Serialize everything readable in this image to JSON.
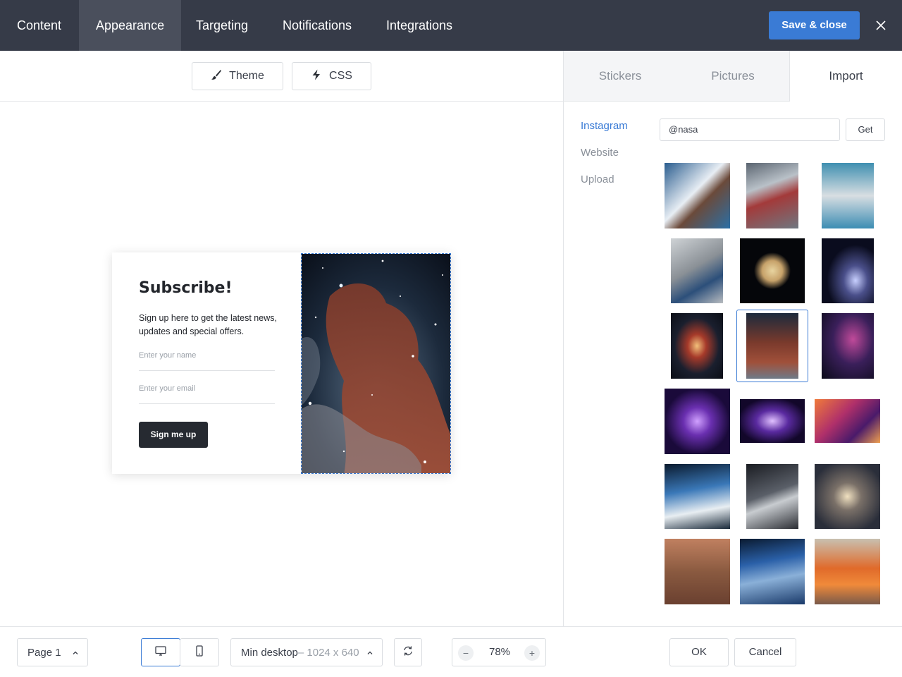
{
  "topbar": {
    "tabs": [
      {
        "label": "Content"
      },
      {
        "label": "Appearance"
      },
      {
        "label": "Targeting"
      },
      {
        "label": "Notifications"
      },
      {
        "label": "Integrations"
      }
    ],
    "active_tab": "Appearance",
    "save_label": "Save & close",
    "close_icon": "close-icon"
  },
  "subbar": {
    "theme_label": "Theme",
    "theme_icon": "brush-icon",
    "css_label": "CSS",
    "css_icon": "lightning-icon"
  },
  "popup": {
    "title": "Subscribe!",
    "text": "Sign up here to get the latest news, updates and special offers.",
    "name_placeholder": "Enter your name",
    "email_placeholder": "Enter your email",
    "button_label": "Sign me up",
    "image": "horsehead-nebula"
  },
  "bottombar": {
    "page_label": "Page 1",
    "device_desktop_icon": "desktop-icon",
    "device_mobile_icon": "mobile-icon",
    "size_label": "Min desktop",
    "size_value": "– 1024 x 640",
    "zoom": "78%",
    "zoom_minus": "−",
    "zoom_plus": "+"
  },
  "rightpanel": {
    "tabs": [
      {
        "label": "Stickers"
      },
      {
        "label": "Pictures"
      },
      {
        "label": "Import"
      }
    ],
    "active_tab": "Import",
    "sources": [
      {
        "label": "Instagram"
      },
      {
        "label": "Website"
      },
      {
        "label": "Upload"
      }
    ],
    "active_source": "Instagram",
    "handle_value": "@nasa",
    "get_label": "Get",
    "ok_label": "OK",
    "cancel_label": "Cancel",
    "selected_image": "horsehead-nebula",
    "images": [
      "astronaut-lab-white-coat",
      "space-station-interior",
      "astronaut-pool-training",
      "astronaut-station-work",
      "saturn",
      "spiral-galaxy-pair",
      "starburst-galaxy",
      "horsehead-nebula",
      "purple-nebula-field",
      "purple-galaxy-cluster",
      "purple-galaxy-strip",
      "magenta-dark-matter",
      "earth-spacewalk",
      "astronaut-window",
      "spiral-galaxy-closeup",
      "mars-rover",
      "earth-horizon",
      "astronaut-orange-suit"
    ]
  },
  "colors": {
    "topbar_bg": "#363b48",
    "accent": "#3a7bd5",
    "card_button": "#262a31"
  }
}
